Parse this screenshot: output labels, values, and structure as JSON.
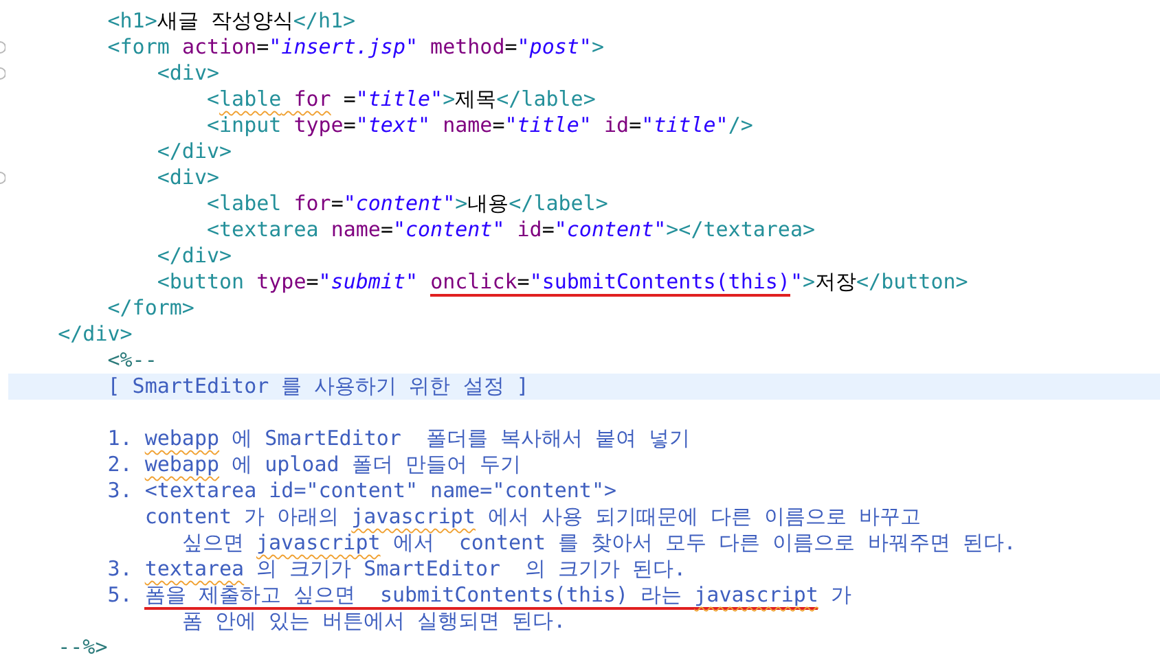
{
  "editor": {
    "lines": [
      {
        "fold": false,
        "current": false,
        "tokens": [
          {
            "kind": "tag",
            "text": "        <h1>"
          },
          {
            "kind": "text",
            "text": "새글 작성양식"
          },
          {
            "kind": "tag",
            "text": "</h1>"
          }
        ]
      },
      {
        "fold": true,
        "current": false,
        "tokens": [
          {
            "kind": "tag",
            "text": "        <form "
          },
          {
            "kind": "attr",
            "text": "action"
          },
          {
            "kind": "text",
            "text": "="
          },
          {
            "kind": "str",
            "text": "\"insert.jsp\""
          },
          {
            "kind": "attr",
            "text": " method"
          },
          {
            "kind": "text",
            "text": "="
          },
          {
            "kind": "str",
            "text": "\"post\""
          },
          {
            "kind": "tag",
            "text": ">"
          }
        ]
      },
      {
        "fold": true,
        "current": false,
        "tokens": [
          {
            "kind": "tag",
            "text": "            <div>"
          }
        ]
      },
      {
        "fold": false,
        "current": false,
        "tokens": [
          {
            "kind": "tag",
            "text": "                <"
          },
          {
            "kind": "tag",
            "text": "lable",
            "misspelled": true
          },
          {
            "kind": "attr",
            "text": " for",
            "misspelled": true
          },
          {
            "kind": "text",
            "text": " ="
          },
          {
            "kind": "str",
            "text": "\"title\""
          },
          {
            "kind": "tag",
            "text": ">"
          },
          {
            "kind": "text",
            "text": "제목"
          },
          {
            "kind": "tag",
            "text": "</lable>"
          }
        ]
      },
      {
        "fold": false,
        "current": false,
        "tokens": [
          {
            "kind": "tag",
            "text": "                <input "
          },
          {
            "kind": "attr",
            "text": "type"
          },
          {
            "kind": "text",
            "text": "="
          },
          {
            "kind": "str",
            "text": "\"text\""
          },
          {
            "kind": "attr",
            "text": " name"
          },
          {
            "kind": "text",
            "text": "="
          },
          {
            "kind": "str",
            "text": "\"title\""
          },
          {
            "kind": "attr",
            "text": " id"
          },
          {
            "kind": "text",
            "text": "="
          },
          {
            "kind": "str",
            "text": "\"title\""
          },
          {
            "kind": "tag",
            "text": "/>"
          }
        ]
      },
      {
        "fold": false,
        "current": false,
        "tokens": [
          {
            "kind": "tag",
            "text": "            </div>"
          }
        ]
      },
      {
        "fold": true,
        "current": false,
        "tokens": [
          {
            "kind": "tag",
            "text": "            <div>"
          }
        ]
      },
      {
        "fold": false,
        "current": false,
        "tokens": [
          {
            "kind": "tag",
            "text": "                <label "
          },
          {
            "kind": "attr",
            "text": "for"
          },
          {
            "kind": "text",
            "text": "="
          },
          {
            "kind": "str",
            "text": "\"content\""
          },
          {
            "kind": "tag",
            "text": ">"
          },
          {
            "kind": "text",
            "text": "내용"
          },
          {
            "kind": "tag",
            "text": "</label>"
          }
        ]
      },
      {
        "fold": false,
        "current": false,
        "tokens": [
          {
            "kind": "tag",
            "text": "                <textarea "
          },
          {
            "kind": "attr",
            "text": "name"
          },
          {
            "kind": "text",
            "text": "="
          },
          {
            "kind": "str",
            "text": "\"content\""
          },
          {
            "kind": "attr",
            "text": " id"
          },
          {
            "kind": "text",
            "text": "="
          },
          {
            "kind": "str",
            "text": "\"content\""
          },
          {
            "kind": "tag",
            "text": "></textarea>"
          }
        ]
      },
      {
        "fold": false,
        "current": false,
        "tokens": [
          {
            "kind": "tag",
            "text": "            </div>"
          }
        ]
      },
      {
        "fold": false,
        "current": false,
        "tokens": [
          {
            "kind": "tag",
            "text": "            <button "
          },
          {
            "kind": "attr",
            "text": "type"
          },
          {
            "kind": "text",
            "text": "="
          },
          {
            "kind": "str",
            "text": "\"submit\" "
          },
          {
            "kind": "attr",
            "text": "onclick",
            "underlined": true
          },
          {
            "kind": "text",
            "text": "=",
            "underlined": true
          },
          {
            "kind": "plainstr",
            "text": "\"submitContents(this)",
            "underlined": true
          },
          {
            "kind": "plainstr",
            "text": "\""
          },
          {
            "kind": "tag",
            "text": ">"
          },
          {
            "kind": "text",
            "text": "저장"
          },
          {
            "kind": "tag",
            "text": "</button>"
          }
        ]
      },
      {
        "fold": false,
        "current": false,
        "tokens": [
          {
            "kind": "tag",
            "text": "        </form>"
          }
        ]
      },
      {
        "fold": false,
        "current": false,
        "tokens": [
          {
            "kind": "tag",
            "text": "    </div>"
          }
        ]
      },
      {
        "fold": false,
        "current": false,
        "tokens": [
          {
            "kind": "jsp",
            "text": "        <%--"
          }
        ]
      },
      {
        "fold": false,
        "current": true,
        "tokens": [
          {
            "kind": "comment",
            "text": "        [ SmartEditor 를 사용하기 위한 설정 ]"
          }
        ]
      },
      {
        "fold": false,
        "current": false
      },
      {
        "fold": false,
        "current": false,
        "tokens": [
          {
            "kind": "comment",
            "text": "        1. "
          },
          {
            "kind": "comment",
            "text": "webapp",
            "misspelled": true
          },
          {
            "kind": "comment",
            "text": " 에 SmartEditor  폴더를 복사해서 붙여 넣기"
          }
        ]
      },
      {
        "fold": false,
        "current": false,
        "tokens": [
          {
            "kind": "comment",
            "text": "        2. "
          },
          {
            "kind": "comment",
            "text": "webapp",
            "misspelled": true
          },
          {
            "kind": "comment",
            "text": " 에 upload 폴더 만들어 두기"
          }
        ]
      },
      {
        "fold": false,
        "current": false,
        "tokens": [
          {
            "kind": "comment",
            "text": "        3. <textarea id=\"content\" name=\"content\">"
          }
        ]
      },
      {
        "fold": false,
        "current": false,
        "tokens": [
          {
            "kind": "comment",
            "text": "           content 가 아래의 "
          },
          {
            "kind": "comment",
            "text": "javascript",
            "misspelled": true
          },
          {
            "kind": "comment",
            "text": " 에서 사용 되기때문에 다른 이름으로 바꾸고"
          }
        ]
      },
      {
        "fold": false,
        "current": false,
        "tokens": [
          {
            "kind": "comment",
            "text": "              싶으면 "
          },
          {
            "kind": "comment",
            "text": "javascript",
            "misspelled": true
          },
          {
            "kind": "comment",
            "text": " 에서  content 를 찾아서 모두 다른 이름으로 바꿔주면 된다."
          }
        ]
      },
      {
        "fold": false,
        "current": false,
        "tokens": [
          {
            "kind": "comment",
            "text": "        3. "
          },
          {
            "kind": "comment",
            "text": "textarea",
            "misspelled": true
          },
          {
            "kind": "comment",
            "text": " 의 크기가 SmartEditor  의 크기가 된다."
          }
        ]
      },
      {
        "fold": false,
        "current": false,
        "tokens": [
          {
            "kind": "comment",
            "text": "        5. "
          },
          {
            "kind": "comment",
            "text": "폼을 제출하고 싶으면  submitContents(this) 라는 ",
            "underlined": true
          },
          {
            "kind": "comment",
            "text": "javascript",
            "misspelled": true,
            "underlined": true
          },
          {
            "kind": "comment",
            "text": " 가"
          }
        ]
      },
      {
        "fold": false,
        "current": false,
        "tokens": [
          {
            "kind": "comment",
            "text": "              폼 안에 있는 버튼에서 실행되면 된다."
          }
        ]
      },
      {
        "fold": false,
        "current": false,
        "tokens": [
          {
            "kind": "jsp",
            "text": "    --%>"
          }
        ]
      }
    ]
  }
}
